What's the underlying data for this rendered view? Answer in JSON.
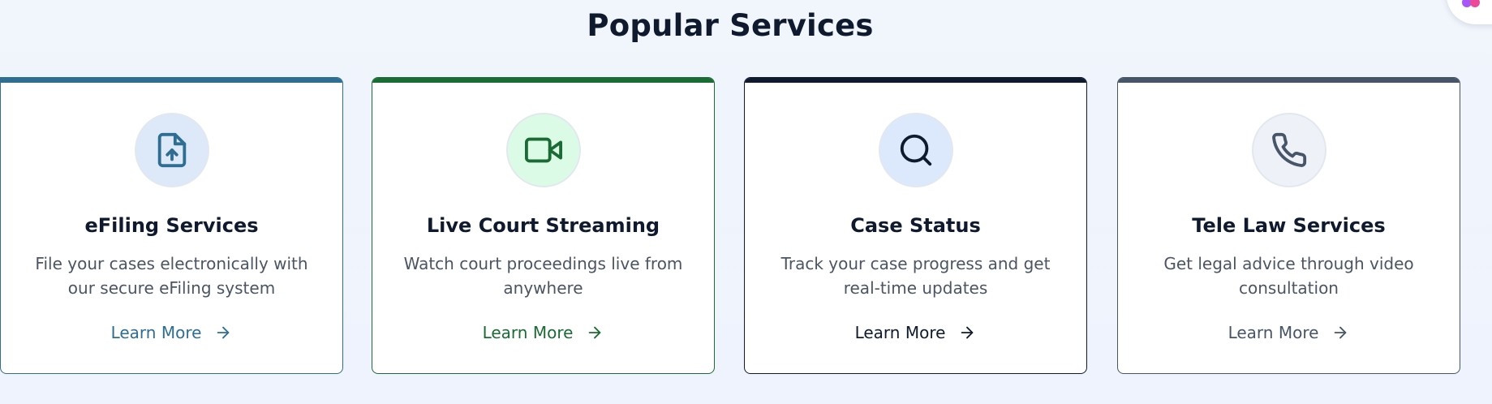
{
  "section": {
    "title": "Popular Services"
  },
  "cards": [
    {
      "title": "eFiling Services",
      "description": "File your cases electronically with our secure eFiling system",
      "link_label": "Learn More",
      "icon": "file-upload-icon",
      "accent": "#2e6e93",
      "icon_bg": "#dde9f8"
    },
    {
      "title": "Live Court Streaming",
      "description": "Watch court proceedings live from anywhere",
      "link_label": "Learn More",
      "icon": "video-camera-icon",
      "accent": "#1b6b34",
      "icon_bg": "#dcfbe6"
    },
    {
      "title": "Case Status",
      "description": "Track your case progress and get real-time updates",
      "link_label": "Learn More",
      "icon": "search-icon",
      "accent": "#0f1a2e",
      "icon_bg": "#dce9fc"
    },
    {
      "title": "Tele Law Services",
      "description": "Get legal advice through video consultation",
      "link_label": "Learn More",
      "icon": "phone-icon",
      "accent": "#475569",
      "icon_bg": "#eef2f8"
    }
  ]
}
